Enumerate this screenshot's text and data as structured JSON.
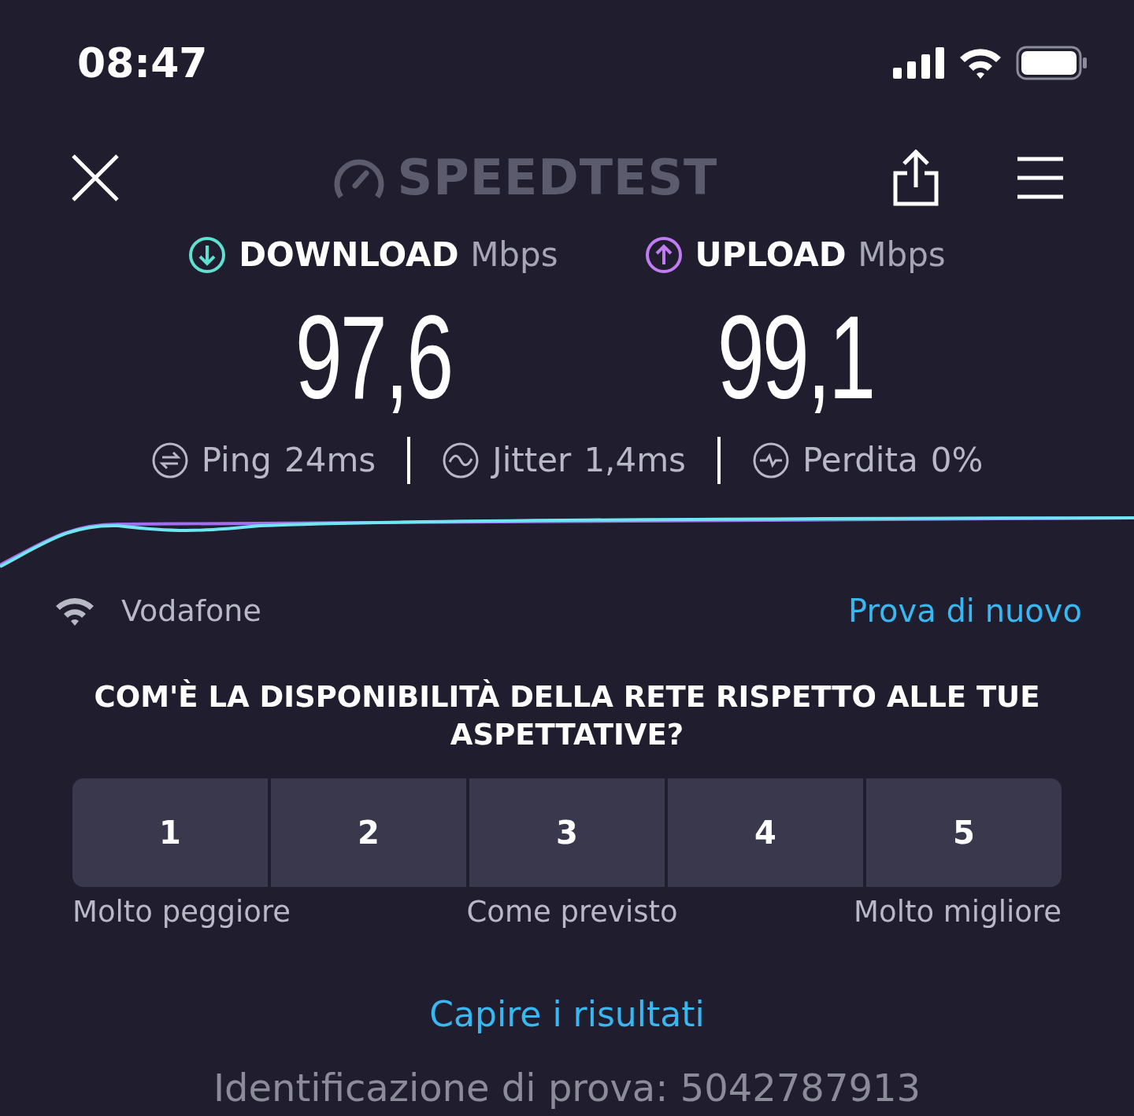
{
  "status_bar": {
    "time": "08:47"
  },
  "header": {
    "logo": "SPEEDTEST"
  },
  "results": [
    {
      "kind": "download",
      "label": "DOWNLOAD",
      "unit": "Mbps",
      "value": "97,6",
      "color": "#5fe0d0"
    },
    {
      "kind": "upload",
      "label": "UPLOAD",
      "unit": "Mbps",
      "value": "99,1",
      "color": "#c07cf0"
    }
  ],
  "metrics": [
    {
      "kind": "ping",
      "label": "Ping",
      "value": "24ms"
    },
    {
      "kind": "jitter",
      "label": "Jitter",
      "value": "1,4ms"
    },
    {
      "kind": "loss",
      "label": "Perdita",
      "value": "0%"
    }
  ],
  "provider": {
    "name": "Vodafone",
    "retry_link": "Prova di nuovo"
  },
  "survey": {
    "question": "COM'È LA DISPONIBILITÀ DELLA RETE RISPETTO ALLE TUE ASPETTATIVE?",
    "options": [
      {
        "label": "1",
        "selected": false
      },
      {
        "label": "2",
        "selected": false
      },
      {
        "label": "3",
        "selected": false
      },
      {
        "label": "4",
        "selected": false
      },
      {
        "label": "5",
        "selected": false
      }
    ],
    "scale_labels": [
      "Molto peggiore",
      "Come previsto",
      "Molto migliore"
    ]
  },
  "results_link": "Capire i risultati",
  "test_id": "Identificazione di prova: 5042787913"
}
